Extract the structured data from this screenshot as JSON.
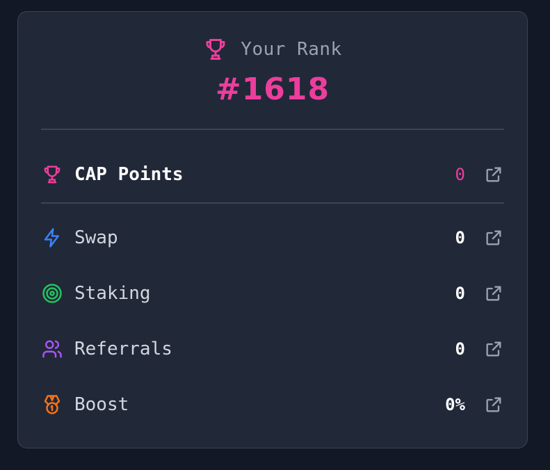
{
  "rank": {
    "label": "Your Rank",
    "value": "#1618",
    "icon": "trophy-icon"
  },
  "total": {
    "label": "CAP Points",
    "value": "0",
    "icon": "trophy-icon"
  },
  "items": [
    {
      "label": "Swap",
      "value": "0",
      "icon": "lightning-icon",
      "color": "#3b82f6"
    },
    {
      "label": "Staking",
      "value": "0",
      "icon": "target-icon",
      "color": "#22c55e"
    },
    {
      "label": "Referrals",
      "value": "0",
      "icon": "users-icon",
      "color": "#a855f7"
    },
    {
      "label": "Boost",
      "value": "0%",
      "icon": "medal-icon",
      "color": "#f97316"
    }
  ],
  "colors": {
    "accent": "#ec3e9c",
    "card_bg": "#212838",
    "page_bg": "#121826",
    "link_icon": "#9aa3b2"
  }
}
